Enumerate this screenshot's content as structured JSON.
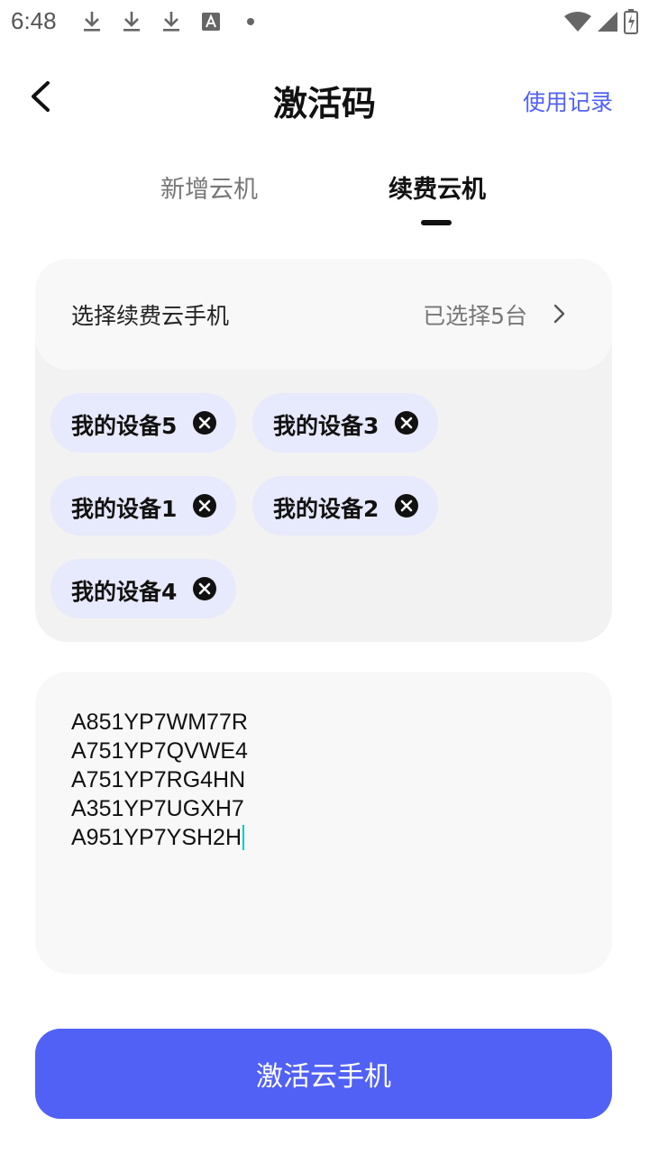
{
  "status_bar": {
    "time": "6:48",
    "left_icons": [
      "download-icon",
      "download-icon",
      "download-icon",
      "font-a-icon",
      "dot-icon"
    ],
    "right_icons": [
      "wifi-icon",
      "signal-icon",
      "battery-icon"
    ]
  },
  "header": {
    "title": "激活码",
    "history_link": "使用记录",
    "back_icon": "chevron-left-icon"
  },
  "tabs": [
    {
      "label": "新增云机",
      "active": false
    },
    {
      "label": "续费云机",
      "active": true
    }
  ],
  "device_select": {
    "label": "选择续费云手机",
    "selected_count_text": "已选择5台",
    "chips": [
      {
        "label": "我的设备5"
      },
      {
        "label": "我的设备3"
      },
      {
        "label": "我的设备1"
      },
      {
        "label": "我的设备2"
      },
      {
        "label": "我的设备4"
      }
    ]
  },
  "codes": {
    "lines": [
      "A851YP7WM77R",
      "A751YP7QVWE4",
      "A751YP7RG4HN",
      "A351YP7UGXH7",
      "A951YP7YSH2H"
    ]
  },
  "activate_button": {
    "label": "激活云手机"
  },
  "colors": {
    "accent": "#5161f5",
    "chip_bg": "#e7e9fc",
    "card_bg": "#f2f2f2",
    "card_head_bg": "#f8f8f8",
    "cursor": "#19c4c4"
  }
}
